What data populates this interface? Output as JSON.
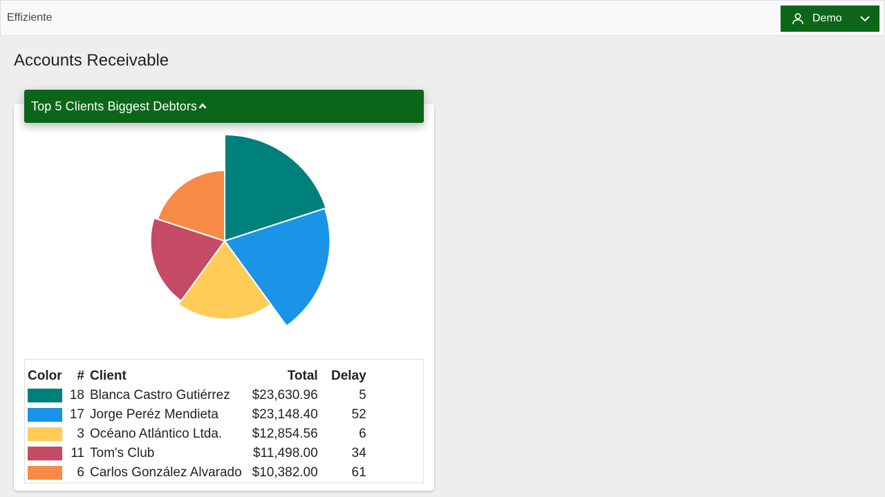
{
  "app": {
    "brand": "Effiziente",
    "user": "Demo",
    "accent": "#0b6619"
  },
  "page": {
    "title": "Accounts Receivable"
  },
  "card": {
    "title": "Top 5 Clients Biggest Debtors"
  },
  "table": {
    "headers": {
      "color": "Color",
      "num": "#",
      "client": "Client",
      "total": "Total",
      "delay": "Delay"
    },
    "rows": [
      {
        "color": "#00807a",
        "num": "18",
        "client": "Blanca Castro Gutiérrez",
        "total": "$23,630.96",
        "delay": "5"
      },
      {
        "color": "#1994e6",
        "num": "17",
        "client": "Jorge Peréz Mendieta",
        "total": "$23,148.40",
        "delay": "52"
      },
      {
        "color": "#ffcd57",
        "num": "3",
        "client": "Océano Atlántico Ltda.",
        "total": "$12,854.56",
        "delay": "6"
      },
      {
        "color": "#c54a63",
        "num": "11",
        "client": "Tom's Club",
        "total": "$11,498.00",
        "delay": "34"
      },
      {
        "color": "#f78a45",
        "num": "6",
        "client": "Carlos González Alvarado",
        "total": "$10,382.00",
        "delay": "61"
      }
    ]
  },
  "chart_data": {
    "type": "pie",
    "categories": [
      "Blanca Castro Gutiérrez",
      "Jorge Peréz Mendieta",
      "Océano Atlántico Ltda.",
      "Tom's Club",
      "Carlos González Alvarado"
    ],
    "values": [
      23630.96,
      23148.4,
      12854.56,
      11498.0,
      10382.0
    ],
    "colors": [
      "#00807a",
      "#1994e6",
      "#ffcd57",
      "#c54a63",
      "#f78a45"
    ],
    "style": "polar-area",
    "start_angle_deg": 0,
    "direction": "clockwise",
    "legend": "table-below"
  }
}
